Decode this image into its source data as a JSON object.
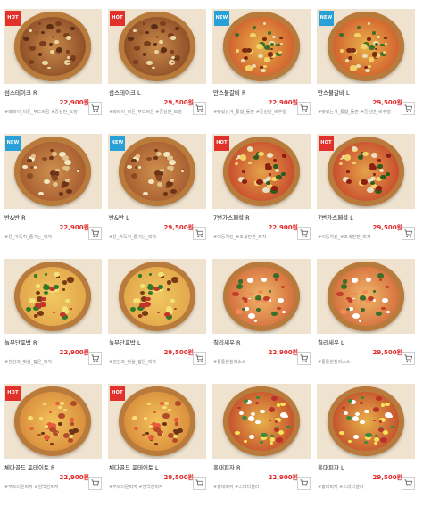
{
  "badge_colors": {
    "HOT": "#e0322b",
    "NEW": "#2aa0d9"
  },
  "price_color": "#e32a2a",
  "products": [
    {
      "badge": "HOT",
      "name": "섬스테이크 R",
      "price": "22,900원",
      "tags": "#와퍼이_더든_부드러움 #중심만_토핑",
      "style": "steak"
    },
    {
      "badge": "HOT",
      "name": "섬스테이크 L",
      "price": "29,500원",
      "tags": "#와퍼이_더든_부드러움 #중심만_토핑",
      "style": "steak"
    },
    {
      "badge": "NEW",
      "name": "만스불갈비 R",
      "price": "22,900원",
      "tags": "#맛있는거_통합_돌판 #중심만_비주얼",
      "style": "bulgogi"
    },
    {
      "badge": "NEW",
      "name": "만스불갈비 L",
      "price": "29,500원",
      "tags": "#맛있는거_통합_돌판 #중심만_비주얼",
      "style": "bulgogi"
    },
    {
      "badge": "NEW",
      "name": "반&반 R",
      "price": "22,900원",
      "tags": "#은_가득히_즐기는_피자",
      "style": "half"
    },
    {
      "badge": "NEW",
      "name": "반&반 L",
      "price": "29,500원",
      "tags": "#은_가득히_즐기는_피자",
      "style": "half"
    },
    {
      "badge": "HOT",
      "name": "7번가스페셜 R",
      "price": "22,900원",
      "tags": "#이동치킨_#조세만판_피자",
      "style": "special"
    },
    {
      "badge": "HOT",
      "name": "7번가스페셜 L",
      "price": "29,500원",
      "tags": "#이동치킨_#조세만판_피자",
      "style": "special"
    },
    {
      "badge": "",
      "name": "놀부단포박 R",
      "price": "22,900원",
      "tags": "#건강과_맛을_잡은_피자",
      "style": "veggie"
    },
    {
      "badge": "",
      "name": "놀부단포박 L",
      "price": "29,500원",
      "tags": "#건강과_맛을_잡은_피자",
      "style": "veggie"
    },
    {
      "badge": "",
      "name": "칠리새우 R",
      "price": "22,900원",
      "tags": "#통통한칠리소스",
      "style": "shrimp"
    },
    {
      "badge": "",
      "name": "칠리새우 L",
      "price": "29,500원",
      "tags": "#통통한칠리소스",
      "style": "shrimp"
    },
    {
      "badge": "HOT",
      "name": "체다골드 포테이토 R",
      "price": "22,900원",
      "tags": "#부드러운피자 #담백한피자",
      "style": "potato"
    },
    {
      "badge": "HOT",
      "name": "체다골드 포테이토 L",
      "price": "29,500원",
      "tags": "#부드러운피자 #담백한피자",
      "style": "potato"
    },
    {
      "badge": "",
      "name": "홍대피자 R",
      "price": "22,900원",
      "tags": "#홍대피자 #스테디셀러",
      "style": "hongdae"
    },
    {
      "badge": "",
      "name": "홍대피자 L",
      "price": "29,500원",
      "tags": "#홍대피자 #스테디셀러",
      "style": "hongdae"
    }
  ]
}
